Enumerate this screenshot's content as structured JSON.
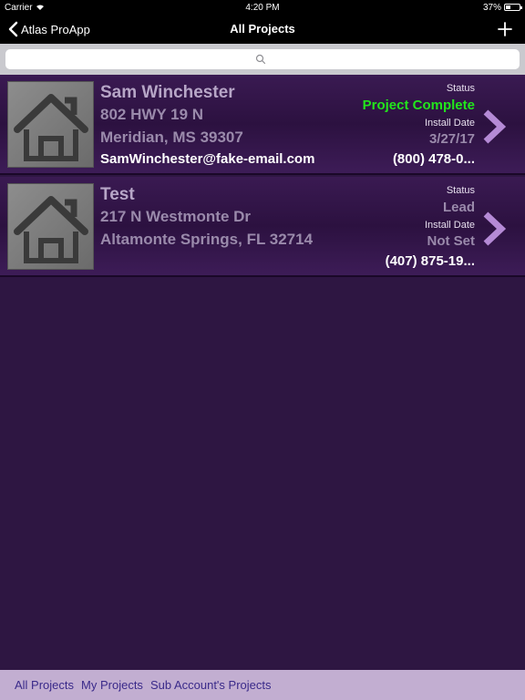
{
  "status_bar": {
    "carrier": "Carrier",
    "time": "4:20 PM",
    "battery_pct": "37%",
    "battery_level": 0.37
  },
  "nav": {
    "back_label": "Atlas ProApp",
    "title": "All Projects",
    "add_icon": "plus-icon"
  },
  "search": {
    "placeholder": "",
    "icon": "search-icon"
  },
  "colors": {
    "background": "#2e1642",
    "status_complete": "#22e51c",
    "status_default": "#9a8aab",
    "chevron": "#b58ad6",
    "tabbar_bg": "#c2aed1",
    "tab_text": "#3a2a8a"
  },
  "projects": [
    {
      "name": "Sam Winchester",
      "address_line1": "802 HWY 19 N",
      "address_line2": "Meridian, MS 39307",
      "email": "SamWinchester@fake-email.com",
      "status_label": "Status",
      "status": "Project Complete",
      "install_label": "Install Date",
      "install_date": "3/27/17",
      "phone": "(800) 478-0..."
    },
    {
      "name": "Test",
      "address_line1": "217 N Westmonte Dr",
      "address_line2": "Altamonte Springs, FL 32714",
      "email": "",
      "status_label": "Status",
      "status": "Lead",
      "install_label": "Install Date",
      "install_date": "Not Set",
      "phone": "(407) 875-19..."
    }
  ],
  "tabs": [
    {
      "label": "All Projects"
    },
    {
      "label": "My Projects"
    },
    {
      "label": "Sub Account's Projects"
    }
  ]
}
